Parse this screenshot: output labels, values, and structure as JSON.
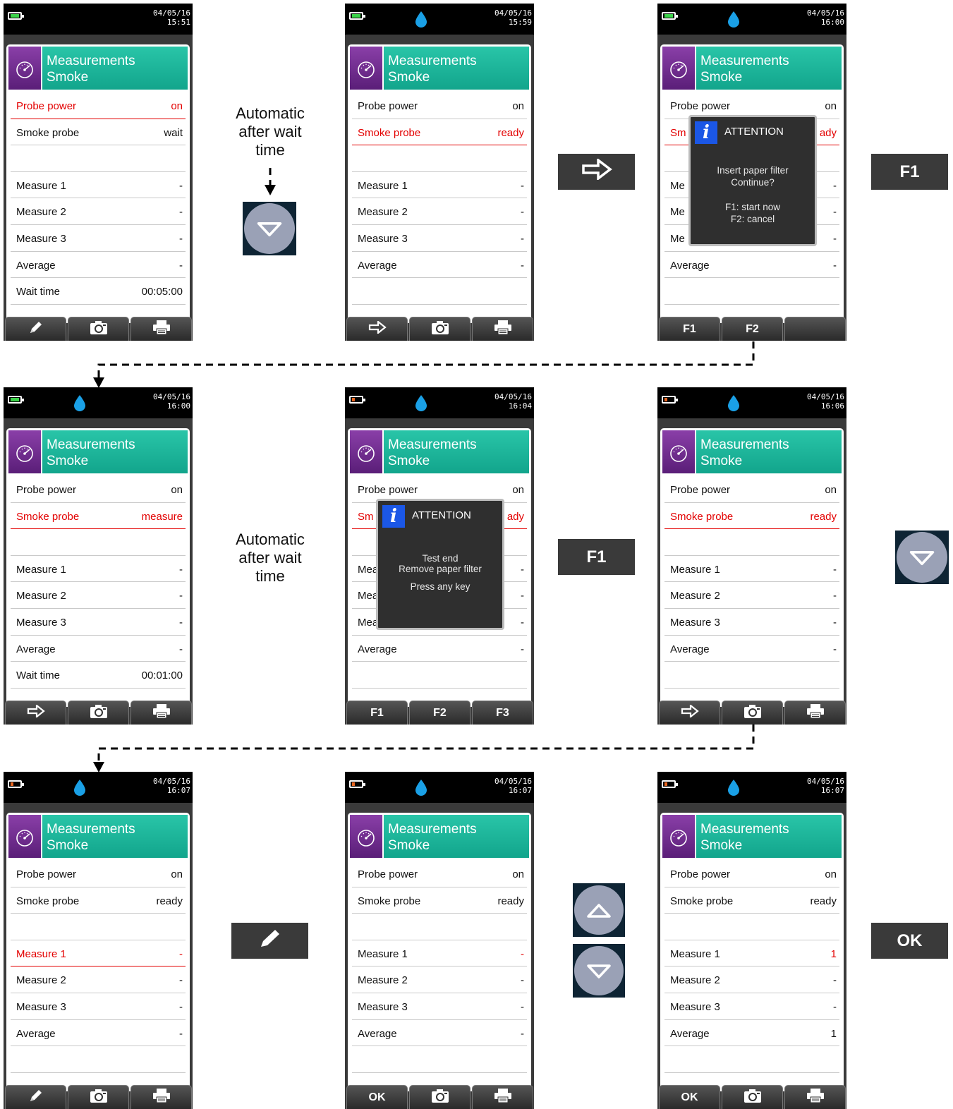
{
  "screens": [
    {
      "date": "04/05/16",
      "time": "15:51",
      "battery": "green",
      "drop": false,
      "title1": "Measurements",
      "title2": "Smoke",
      "rows": [
        {
          "label": "Probe power",
          "value": "on",
          "red": true
        },
        {
          "label": "Smoke probe",
          "value": "wait"
        },
        {
          "label": "",
          "value": ""
        },
        {
          "label": "Measure 1",
          "value": "-"
        },
        {
          "label": "Measure 2",
          "value": "-"
        },
        {
          "label": "Measure 3",
          "value": "-"
        },
        {
          "label": "Average",
          "value": "-"
        },
        {
          "label": "Wait time",
          "value": "00:05:00"
        }
      ],
      "tabs": [
        "pencil-icon",
        "camera-icon",
        "printer-icon"
      ]
    },
    {
      "date": "04/05/16",
      "time": "15:59",
      "battery": "green",
      "drop": true,
      "title1": "Measurements",
      "title2": "Smoke",
      "rows": [
        {
          "label": "Probe power",
          "value": "on"
        },
        {
          "label": "Smoke probe",
          "value": "ready",
          "red": true
        },
        {
          "label": "",
          "value": ""
        },
        {
          "label": "Measure 1",
          "value": "-"
        },
        {
          "label": "Measure 2",
          "value": "-"
        },
        {
          "label": "Measure 3",
          "value": "-"
        },
        {
          "label": "Average",
          "value": "-"
        },
        {
          "label": "",
          "value": ""
        }
      ],
      "tabs": [
        "arrow-icon",
        "camera-icon",
        "printer-icon"
      ]
    },
    {
      "date": "04/05/16",
      "time": "16:00",
      "battery": "green",
      "drop": true,
      "title1": "Measurements",
      "title2": "Smoke",
      "rows": [
        {
          "label": "Probe power",
          "value": "on"
        },
        {
          "label": "Sm",
          "value": "ady",
          "red": true
        },
        {
          "label": "",
          "value": ""
        },
        {
          "label": "Me",
          "value": "-"
        },
        {
          "label": "Me",
          "value": "-"
        },
        {
          "label": "Me",
          "value": "-"
        },
        {
          "label": "Average",
          "value": "-"
        },
        {
          "label": "",
          "value": ""
        }
      ],
      "tabs": [
        "F1",
        "F2",
        ""
      ],
      "popup": {
        "title": "ATTENTION",
        "lines": [
          "Insert paper filter",
          "Continue?",
          "",
          "F1: start now",
          "F2: cancel"
        ]
      }
    },
    {
      "date": "04/05/16",
      "time": "16:00",
      "battery": "green",
      "drop": true,
      "title1": "Measurements",
      "title2": "Smoke",
      "rows": [
        {
          "label": "Probe power",
          "value": "on"
        },
        {
          "label": "Smoke probe",
          "value": "measure",
          "red": true
        },
        {
          "label": "",
          "value": ""
        },
        {
          "label": "Measure 1",
          "value": "-"
        },
        {
          "label": "Measure 2",
          "value": "-"
        },
        {
          "label": "Measure 3",
          "value": "-"
        },
        {
          "label": "Average",
          "value": "-"
        },
        {
          "label": "Wait time",
          "value": "00:01:00"
        }
      ],
      "tabs": [
        "arrow-icon",
        "camera-icon",
        "printer-icon"
      ]
    },
    {
      "date": "04/05/16",
      "time": "16:04",
      "battery": "orange",
      "drop": true,
      "title1": "Measurements",
      "title2": "Smoke",
      "rows": [
        {
          "label": "Probe power",
          "value": "on"
        },
        {
          "label": "Sm",
          "value": "ady",
          "red": true
        },
        {
          "label": "",
          "value": ""
        },
        {
          "label": "Mea",
          "value": "-"
        },
        {
          "label": "Mea",
          "value": "-"
        },
        {
          "label": "Mea",
          "value": "-"
        },
        {
          "label": "Average",
          "value": "-"
        },
        {
          "label": "",
          "value": ""
        }
      ],
      "tabs": [
        "F1",
        "F2",
        "F3"
      ],
      "popup": {
        "title": "ATTENTION",
        "lines": [
          "Test end",
          "Remove paper filter",
          "",
          "Press any key"
        ]
      }
    },
    {
      "date": "04/05/16",
      "time": "16:06",
      "battery": "orange",
      "drop": true,
      "title1": "Measurements",
      "title2": "Smoke",
      "rows": [
        {
          "label": "Probe power",
          "value": "on"
        },
        {
          "label": "Smoke probe",
          "value": "ready",
          "red": true
        },
        {
          "label": "",
          "value": ""
        },
        {
          "label": "Measure 1",
          "value": "-"
        },
        {
          "label": "Measure 2",
          "value": "-"
        },
        {
          "label": "Measure 3",
          "value": "-"
        },
        {
          "label": "Average",
          "value": "-"
        },
        {
          "label": "",
          "value": ""
        }
      ],
      "tabs": [
        "arrow-icon",
        "camera-icon",
        "printer-icon"
      ]
    },
    {
      "date": "04/05/16",
      "time": "16:07",
      "battery": "orange",
      "drop": true,
      "title1": "Measurements",
      "title2": "Smoke",
      "rows": [
        {
          "label": "Probe power",
          "value": "on"
        },
        {
          "label": "Smoke probe",
          "value": "ready"
        },
        {
          "label": "",
          "value": ""
        },
        {
          "label": "Measure 1",
          "value": "-",
          "red": true
        },
        {
          "label": "Measure 2",
          "value": "-"
        },
        {
          "label": "Measure 3",
          "value": "-"
        },
        {
          "label": "Average",
          "value": "-"
        },
        {
          "label": "",
          "value": ""
        }
      ],
      "tabs": [
        "pencil-icon",
        "camera-icon",
        "printer-icon"
      ]
    },
    {
      "date": "04/05/16",
      "time": "16:07",
      "battery": "orange",
      "drop": true,
      "title1": "Measurements",
      "title2": "Smoke",
      "rows": [
        {
          "label": "Probe power",
          "value": "on"
        },
        {
          "label": "Smoke probe",
          "value": "ready"
        },
        {
          "label": "",
          "value": ""
        },
        {
          "label": "Measure 1",
          "value": "-",
          "redval": true
        },
        {
          "label": "Measure 2",
          "value": "-"
        },
        {
          "label": "Measure 3",
          "value": "-"
        },
        {
          "label": "Average",
          "value": "-"
        },
        {
          "label": "",
          "value": ""
        }
      ],
      "tabs": [
        "OK",
        "camera-icon",
        "printer-icon"
      ]
    },
    {
      "date": "04/05/16",
      "time": "16:07",
      "battery": "orange",
      "drop": true,
      "title1": "Measurements",
      "title2": "Smoke",
      "rows": [
        {
          "label": "Probe power",
          "value": "on"
        },
        {
          "label": "Smoke probe",
          "value": "ready"
        },
        {
          "label": "",
          "value": ""
        },
        {
          "label": "Measure 1",
          "value": "1",
          "redval": true
        },
        {
          "label": "Measure 2",
          "value": "-"
        },
        {
          "label": "Measure 3",
          "value": "-"
        },
        {
          "label": "Average",
          "value": "1"
        },
        {
          "label": "",
          "value": ""
        }
      ],
      "tabs": [
        "OK",
        "camera-icon",
        "printer-icon"
      ]
    }
  ],
  "notes": {
    "auto1": [
      "Automatic",
      "after wait",
      "time"
    ],
    "auto2": [
      "Automatic",
      "after wait",
      "time"
    ]
  },
  "keys": {
    "arrow": "arrow-icon",
    "f1_top": "F1",
    "f1_mid": "F1",
    "pencil": "pencil-icon",
    "ok": "OK",
    "nav_down_1": "chevron-down-icon",
    "nav_down_2": "chevron-down-icon",
    "nav_up": "chevron-up-icon",
    "nav_down_3": "chevron-down-icon"
  },
  "colors": {
    "highlight": "#e30000",
    "header_teal": "#12a58c",
    "header_purple": "#5a1e78",
    "info_blue": "#1b57e6",
    "drop_blue": "#1aa0e6"
  }
}
